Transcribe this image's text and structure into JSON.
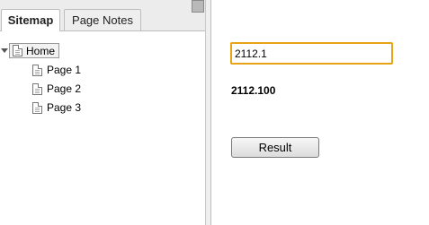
{
  "sidebar": {
    "tabs": [
      {
        "label": "Sitemap",
        "active": true
      },
      {
        "label": "Page Notes",
        "active": false
      }
    ],
    "tree": {
      "root": {
        "label": "Home",
        "icon": "page-icon",
        "expanded": true
      },
      "children": [
        {
          "label": "Page 1",
          "icon": "page-icon"
        },
        {
          "label": "Page 2",
          "icon": "page-icon"
        },
        {
          "label": "Page 3",
          "icon": "page-icon"
        }
      ]
    }
  },
  "main": {
    "input_value": "2112.1",
    "result_text": "2112.100",
    "button_label": "Result",
    "input_border_color": "#e8a317"
  }
}
